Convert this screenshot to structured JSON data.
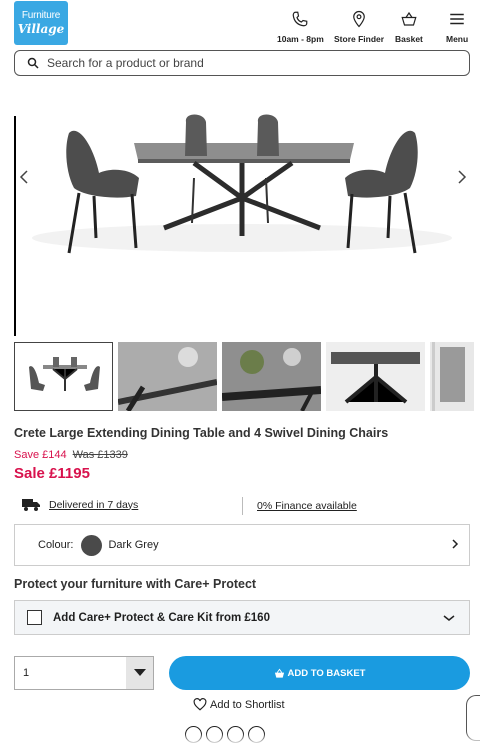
{
  "header": {
    "logo_line1": "Furniture",
    "logo_line2": "Village",
    "nav": [
      {
        "label": "10am - 8pm",
        "icon": "phone-icon"
      },
      {
        "label": "Store Finder",
        "icon": "location-pin-icon"
      },
      {
        "label": "Basket",
        "icon": "basket-icon"
      },
      {
        "label": "Menu",
        "icon": "hamburger-icon"
      }
    ]
  },
  "search": {
    "placeholder": "Search for a product or brand"
  },
  "product": {
    "title": "Crete Large Extending Dining Table and 4 Swivel Dining Chairs",
    "save": "Save £144",
    "was": "Was £1339",
    "sale": "Sale £1195",
    "delivery": "Delivered in 7 days",
    "finance": "0% Finance available"
  },
  "colour": {
    "label": "Colour:",
    "value": "Dark Grey",
    "swatch": "#4a4a4a"
  },
  "care": {
    "heading": "Protect your furniture with Care+ Protect",
    "option": "Add Care+ Protect & Care Kit from £160"
  },
  "purchase": {
    "quantity": "1",
    "add_to_basket": "ADD TO BASKET",
    "shortlist": "Add to Shortlist"
  },
  "colors": {
    "brand": "#3aa8e3",
    "accent": "#1a9be0",
    "sale": "#d8124d"
  }
}
